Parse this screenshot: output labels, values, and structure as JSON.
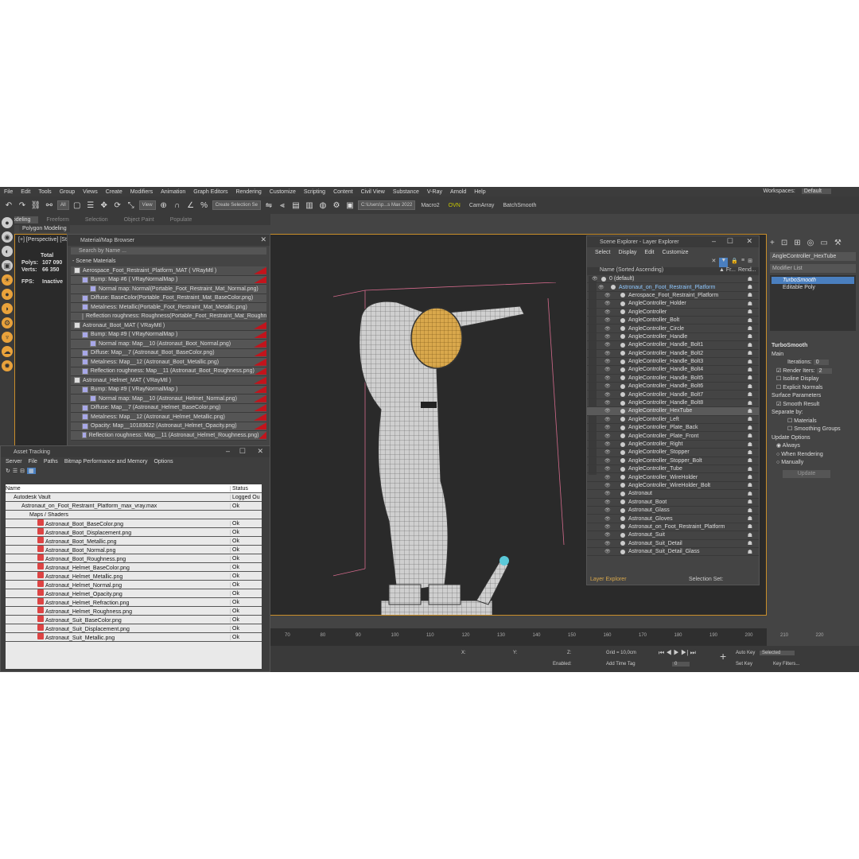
{
  "menu": [
    "File",
    "Edit",
    "Tools",
    "Group",
    "Views",
    "Create",
    "Modifiers",
    "Animation",
    "Graph Editors",
    "Rendering",
    "Customize",
    "Scripting",
    "Content",
    "Civil View",
    "Substance",
    "V-Ray",
    "Arnold",
    "Help"
  ],
  "workspaces_label": "Workspaces:",
  "workspaces_value": "Default",
  "toolbar": {
    "selection_filter": "All",
    "ref_coord": "View",
    "selection_set": "Create Selection Se",
    "path": "C:\\Users\\p...s Max 2022",
    "macro2": "Macro2",
    "ovn": "OVN",
    "camarray": "CamArray",
    "batchsmooth": "BatchSmooth"
  },
  "ribbon_tabs": [
    "Modeling",
    "Freeform",
    "Selection",
    "Object Paint",
    "Populate"
  ],
  "ribbon_sub": "Polygon Modeling",
  "viewport": {
    "label": "[+] [Perspective] [St",
    "stats_total": "Total",
    "polys_label": "Polys:",
    "polys_value": "107 090",
    "verts_label": "Verts:",
    "verts_value": "66 350",
    "fps_label": "FPS:",
    "fps_value": "Inactive"
  },
  "material_browser": {
    "title": "Material/Map Browser",
    "search": "Search by Name ...",
    "section": "- Scene Materials",
    "rows": [
      {
        "t": "Aerospace_Foot_Restraint_Platform_MAT ( VRayMtl )",
        "lvl": 0,
        "red": true
      },
      {
        "t": "Bump: Map #6 ( VRayNormalMap )",
        "lvl": 1,
        "red": true
      },
      {
        "t": "Normal map: Normal(Portable_Foot_Restraint_Mat_Normal.png)",
        "lvl": 2,
        "red": false
      },
      {
        "t": "Diffuse: BaseColor(Portable_Foot_Restraint_Mat_BaseColor.png)",
        "lvl": 1,
        "red": false
      },
      {
        "t": "Metalness: Metallic(Portable_Foot_Restraint_Mat_Metallic.png)",
        "lvl": 1,
        "red": false
      },
      {
        "t": "Reflection roughness: Roughness(Portable_Foot_Restraint_Mat_Roughne",
        "lvl": 1,
        "red": false
      },
      {
        "t": "Astronaut_Boot_MAT ( VRayMtl )",
        "lvl": 0,
        "red": true
      },
      {
        "t": "Bump: Map #9 ( VRayNormalMap )",
        "lvl": 1,
        "red": true
      },
      {
        "t": "Normal map: Map__10 (Astronaut_Boot_Normal.png)",
        "lvl": 2,
        "red": true
      },
      {
        "t": "Diffuse: Map__7 (Astronaut_Boot_BaseColor.png)",
        "lvl": 1,
        "red": true
      },
      {
        "t": "Metalness: Map__12 (Astronaut_Boot_Metallic.png)",
        "lvl": 1,
        "red": true
      },
      {
        "t": "Reflection roughness: Map__11 (Astronaut_Boot_Roughness.png)",
        "lvl": 1,
        "red": true
      },
      {
        "t": "Astronaut_Helmet_MAT ( VRayMtl )",
        "lvl": 0,
        "red": true
      },
      {
        "t": "Bump: Map #9 ( VRayNormalMap )",
        "lvl": 1,
        "red": true
      },
      {
        "t": "Normal map: Map__10 (Astronaut_Helmet_Normal.png)",
        "lvl": 2,
        "red": true
      },
      {
        "t": "Diffuse: Map__7 (Astronaut_Helmet_BaseColor.png)",
        "lvl": 1,
        "red": true
      },
      {
        "t": "Metalness: Map__12 (Astronaut_Helmet_Metallic.png)",
        "lvl": 1,
        "red": true
      },
      {
        "t": "Opacity: Map__10183622 (Astronaut_Helmet_Opacity.png)",
        "lvl": 1,
        "red": true
      },
      {
        "t": "Reflection roughness: Map__11 (Astronaut_Helmet_Roughness.png)",
        "lvl": 1,
        "red": true
      }
    ]
  },
  "asset_tracking": {
    "title": "Asset Tracking",
    "menu": [
      "Server",
      "File",
      "Paths",
      "Bitmap Performance and Memory",
      "Options"
    ],
    "col_name": "Name",
    "col_status": "Status",
    "rows": [
      {
        "n": "Autodesk Vault",
        "s": "Logged Ou",
        "lvl": 1
      },
      {
        "n": "Astronaut_on_Foot_Restraint_Platform_max_vray.max",
        "s": "Ok",
        "lvl": 2
      },
      {
        "n": "Maps / Shaders",
        "s": "",
        "lvl": 3
      },
      {
        "n": "Astronaut_Boot_BaseColor.png",
        "s": "Ok",
        "lvl": 4
      },
      {
        "n": "Astronaut_Boot_Displacement.png",
        "s": "Ok",
        "lvl": 4
      },
      {
        "n": "Astronaut_Boot_Metallic.png",
        "s": "Ok",
        "lvl": 4
      },
      {
        "n": "Astronaut_Boot_Normal.png",
        "s": "Ok",
        "lvl": 4
      },
      {
        "n": "Astronaut_Boot_Roughness.png",
        "s": "Ok",
        "lvl": 4
      },
      {
        "n": "Astronaut_Helmet_BaseColor.png",
        "s": "Ok",
        "lvl": 4
      },
      {
        "n": "Astronaut_Helmet_Metallic.png",
        "s": "Ok",
        "lvl": 4
      },
      {
        "n": "Astronaut_Helmet_Normal.png",
        "s": "Ok",
        "lvl": 4
      },
      {
        "n": "Astronaut_Helmet_Opacity.png",
        "s": "Ok",
        "lvl": 4
      },
      {
        "n": "Astronaut_Helmet_Refraction.png",
        "s": "Ok",
        "lvl": 4
      },
      {
        "n": "Astronaut_Helmet_Roughness.png",
        "s": "Ok",
        "lvl": 4
      },
      {
        "n": "Astronaut_Suit_BaseColor.png",
        "s": "Ok",
        "lvl": 4
      },
      {
        "n": "Astronaut_Suit_Displacement.png",
        "s": "Ok",
        "lvl": 4
      },
      {
        "n": "Astronaut_Suit_Metallic.png",
        "s": "Ok",
        "lvl": 4
      }
    ]
  },
  "scene_explorer": {
    "title": "Scene Explorer - Layer Explorer",
    "menu": [
      "Select",
      "Display",
      "Edit",
      "Customize"
    ],
    "col_name": "Name (Sorted Ascending)",
    "col_fr": "▲ Fr...",
    "col_rend": "Rend...",
    "rows": [
      {
        "n": "0 (default)",
        "lvl": 0
      },
      {
        "n": "Astronaut_on_Foot_Restraint_Platform",
        "lvl": 1,
        "hl": true
      },
      {
        "n": "Aerospace_Foot_Restraint_Platform",
        "lvl": 2
      },
      {
        "n": "AngleController_Holder",
        "lvl": 2
      },
      {
        "n": "AngleController",
        "lvl": 2
      },
      {
        "n": "AngleController_Bolt",
        "lvl": 2
      },
      {
        "n": "AngleController_Circle",
        "lvl": 2
      },
      {
        "n": "AngleController_Handle",
        "lvl": 2
      },
      {
        "n": "AngleController_Handle_Bolt1",
        "lvl": 2
      },
      {
        "n": "AngleController_Handle_Bolt2",
        "lvl": 2
      },
      {
        "n": "AngleController_Handle_Bolt3",
        "lvl": 2
      },
      {
        "n": "AngleController_Handle_Bolt4",
        "lvl": 2
      },
      {
        "n": "AngleController_Handle_Bolt5",
        "lvl": 2
      },
      {
        "n": "AngleController_Handle_Bolt6",
        "lvl": 2
      },
      {
        "n": "AngleController_Handle_Bolt7",
        "lvl": 2
      },
      {
        "n": "AngleController_Handle_Bolt8",
        "lvl": 2
      },
      {
        "n": "AngleController_HexTube",
        "lvl": 2,
        "sel": true
      },
      {
        "n": "AngleController_Left",
        "lvl": 2
      },
      {
        "n": "AngleController_Plate_Back",
        "lvl": 2
      },
      {
        "n": "AngleController_Plate_Front",
        "lvl": 2
      },
      {
        "n": "AngleController_Right",
        "lvl": 2
      },
      {
        "n": "AngleController_Stopper",
        "lvl": 2
      },
      {
        "n": "AngleController_Stopper_Bolt",
        "lvl": 2
      },
      {
        "n": "AngleController_Tube",
        "lvl": 2
      },
      {
        "n": "AngleController_WireHolder",
        "lvl": 2
      },
      {
        "n": "AngleController_WireHolder_Bolt",
        "lvl": 2
      },
      {
        "n": "Astronaut",
        "lvl": 2
      },
      {
        "n": "Astronaut_Boot",
        "lvl": 2
      },
      {
        "n": "Astronaut_Glass",
        "lvl": 2
      },
      {
        "n": "Astronaut_Gloves",
        "lvl": 2
      },
      {
        "n": "Astronaut_on_Foot_Restraint_Platform",
        "lvl": 2
      },
      {
        "n": "Astronaut_Suit",
        "lvl": 2
      },
      {
        "n": "Astronaut_Suit_Detail",
        "lvl": 2
      },
      {
        "n": "Astronaut_Suit_Detail_Glass",
        "lvl": 2
      }
    ],
    "footer_left": "Layer Explorer",
    "footer_right": "Selection Set:"
  },
  "command_panel": {
    "object_name": "AngleController_HexTube",
    "modifier_list": "Modifier List",
    "stack": [
      "TurboSmooth",
      "Editable Poly"
    ],
    "rollout": "TurboSmooth",
    "main": "Main",
    "iterations_label": "Iterations:",
    "iterations_value": "0",
    "render_iters_label": "Render Iters:",
    "render_iters_value": "2",
    "isoline": "Isoline Display",
    "explicit": "Explicit Normals",
    "surface_params": "Surface Parameters",
    "smooth_result": "Smooth Result",
    "separate_by": "Separate by:",
    "materials": "Materials",
    "smoothing_groups": "Smoothing Groups",
    "update_options": "Update Options",
    "always": "Always",
    "when_rendering": "When Rendering",
    "manually": "Manually",
    "update_btn": "Update"
  },
  "timeline_ticks": [
    "70",
    "80",
    "90",
    "100",
    "110",
    "120",
    "130",
    "140",
    "150",
    "160",
    "170",
    "180",
    "190",
    "200",
    "210",
    "220"
  ],
  "status": {
    "x_label": "X:",
    "y_label": "Y:",
    "z_label": "Z:",
    "grid": "Grid = 10,0cm",
    "enabled": "Enabled:",
    "add_time_tag": "Add Time Tag",
    "frame": "0",
    "auto_key": "Auto Key",
    "selected": "Selected",
    "set_key": "Set Key",
    "key_filters": "Key Filters..."
  },
  "colors": {
    "accent": "#c98e2a",
    "selection": "#4a7fbf",
    "red_tag": "#c2141c",
    "helmet": "#d9a84c"
  }
}
